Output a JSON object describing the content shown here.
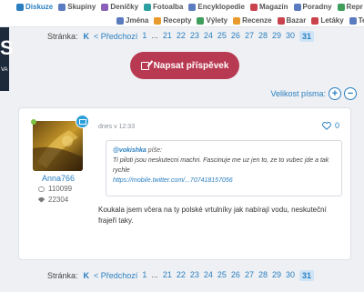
{
  "nav": {
    "row1": [
      {
        "label": "Diskuze",
        "active": true,
        "color": "blue"
      },
      {
        "label": "Skupiny",
        "color": "blue"
      },
      {
        "label": "Deníčky",
        "color": "purple"
      },
      {
        "label": "Fotoalba",
        "color": "teal"
      },
      {
        "label": "Encyklopedie",
        "color": "blue"
      },
      {
        "label": "Magazín",
        "color": "red"
      },
      {
        "label": "Poradny",
        "color": "blue"
      },
      {
        "label": "Repr",
        "color": "green"
      }
    ],
    "row2": [
      {
        "label": "Jména",
        "color": "blue"
      },
      {
        "label": "Recepty",
        "color": "orange"
      },
      {
        "label": "Výlety",
        "color": "green"
      },
      {
        "label": "Recenze",
        "color": "orange"
      },
      {
        "label": "Bazar",
        "color": "red"
      },
      {
        "label": "Letáky",
        "color": "red"
      },
      {
        "label": "Tes",
        "color": "blue"
      }
    ]
  },
  "logo_fragment": {
    "letter": "S",
    "sub": "VA"
  },
  "pagination": {
    "label": "Stránka:",
    "first": "K",
    "prev": "< Předchozí",
    "pages": [
      "1",
      "...",
      "21",
      "22",
      "23",
      "24",
      "25",
      "26",
      "27",
      "28",
      "29",
      "30",
      "31"
    ],
    "current": "31"
  },
  "write_button": {
    "label": "Napsat příspěvek",
    "icon": "pencil-square-icon"
  },
  "font_size": {
    "label": "Velikost písma:",
    "increase": "+",
    "decrease": "−"
  },
  "post": {
    "author": "Anna766",
    "posts_count": "110099",
    "likes_received": "22304",
    "online": true,
    "date": "dnes v 12:33",
    "likes": "0",
    "quote": {
      "author": "@vokishka",
      "said": "píše:",
      "text": "Ti piloti jsou neskutecni machri. Fascinuje me uz jen to, ze to vubec jde a tak rychle",
      "link": "https://mobile.twitter.com/...707418157056"
    },
    "text": "Koukala jsem včera na ty polské vrtulníky jak nabírají vodu, neskuteční frajeři taky."
  }
}
